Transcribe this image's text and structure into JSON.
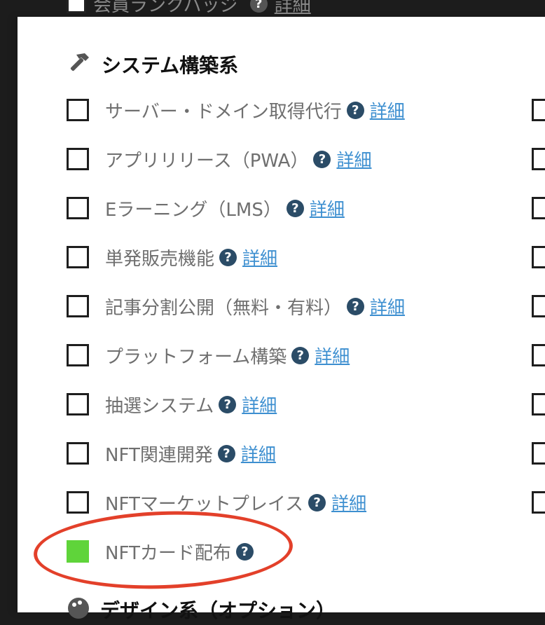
{
  "top_item": {
    "label": "会員ランクバッジ",
    "detail": "詳細"
  },
  "section": {
    "title": "システム構築系",
    "icon": "hammer-icon"
  },
  "items": [
    {
      "label": "サーバー・ドメイン取得代行",
      "detail": "詳細",
      "checked": false
    },
    {
      "label": "アプリリリース（PWA）",
      "detail": "詳細",
      "checked": false
    },
    {
      "label": "Eラーニング（LMS）",
      "detail": "詳細",
      "checked": false
    },
    {
      "label": "単発販売機能",
      "detail": "詳細",
      "checked": false
    },
    {
      "label": "記事分割公開（無料・有料）",
      "detail": "詳細",
      "checked": false
    },
    {
      "label": "プラットフォーム構築",
      "detail": "詳細",
      "checked": false
    },
    {
      "label": "抽選システム",
      "detail": "詳細",
      "checked": false
    },
    {
      "label": "NFT関連開発",
      "detail": "詳細",
      "checked": false
    },
    {
      "label": "NFTマーケットプレイス",
      "detail": "詳細",
      "checked": false
    },
    {
      "label": "NFTカード配布",
      "checked": true
    }
  ],
  "help_glyph": "?",
  "next_section": {
    "title": "デザイン系（オプション）",
    "icon": "palette-icon"
  },
  "colors": {
    "checked": "#5fd43a",
    "help_icon": "#2b4c67",
    "link": "#3d8fd0",
    "highlight_ellipse": "#e3402a"
  }
}
